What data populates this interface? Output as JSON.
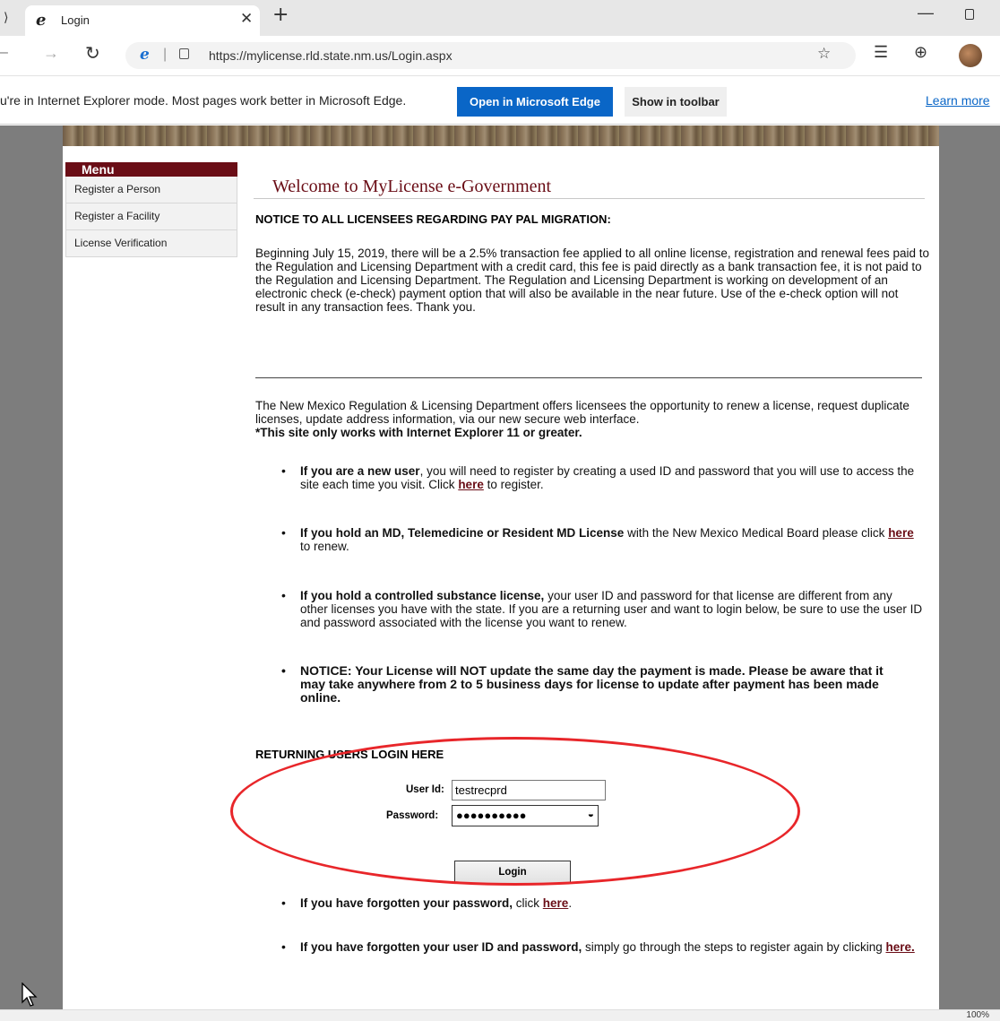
{
  "browser": {
    "tab_title": "Login",
    "url": "https://mylicense.rld.state.nm.us/Login.aspx",
    "zoom": "100%"
  },
  "ie_mode_bar": {
    "message": "u're in Internet Explorer mode. Most pages work better in Microsoft Edge.",
    "open_edge_label": "Open in Microsoft Edge",
    "show_toolbar_label": "Show in toolbar",
    "learn_more_label": "Learn more",
    "accent_color": "#0a66c7"
  },
  "menu": {
    "title": "Menu",
    "items": [
      {
        "label": "Register a Person"
      },
      {
        "label": "Register a Facility"
      },
      {
        "label": "License Verification"
      }
    ]
  },
  "main": {
    "welcome_title": "Welcome to MyLicense e-Government",
    "notice_heading": "NOTICE TO ALL LICENSEES REGARDING PAY PAL MIGRATION:",
    "notice_body": "Beginning July 15, 2019, there will be a 2.5% transaction fee applied to all online license, registration and renewal fees paid to the Regulation and Licensing Department with a credit card, this fee is paid directly as a bank transaction fee, it is not paid to the Regulation and Licensing Department. The Regulation and Licensing Department is working on development of an electronic check (e-check) payment option that will also be available in the near future. Use of the e-check option will not result in any transaction fees. Thank you.",
    "intro": "The New Mexico Regulation & Licensing Department offers licensees the opportunity to renew a license, request duplicate licenses, update address information, via our new secure web interface.",
    "ie_requirement": "*This site only works with Internet Explorer 11 or greater.",
    "bullet_new_user_bold": "If you are a new user",
    "bullet_new_user_text": ", you will need to register by creating a used ID and password that you will use to access the site each time you visit. Click ",
    "bullet_new_user_link": "here",
    "bullet_new_user_tail": " to register.",
    "bullet_md_bold": "If you hold an MD, Telemedicine or Resident MD License",
    "bullet_md_text": " with the New Mexico Medical Board please click ",
    "bullet_md_link": "here",
    "bullet_md_tail": " to renew.",
    "bullet_cs_bold": "If you hold a controlled substance license,",
    "bullet_cs_text": " your user ID and password for that license are different from any other licenses you have with the state. If you are a returning user and want to login below, be sure to use the user ID and password associated with the license you want to renew.",
    "bullet_notice": "NOTICE: Your License will NOT update the same day the payment is made. Please be aware that it may take anywhere from 2 to 5 business days for license to update after payment has been made online.",
    "brand_color": "#6a0d16"
  },
  "login": {
    "heading": "RETURNING USERS LOGIN HERE",
    "user_label": "User Id:",
    "user_value": "testrecprd",
    "password_label": "Password:",
    "password_masked": "●●●●●●●●●●",
    "button_label": "Login",
    "highlight_color": "#e8262a"
  },
  "forgot": {
    "password_bold": "If you have forgotten your password,",
    "password_text": " click ",
    "password_link": "here",
    "password_tail": ".",
    "userid_bold": "If you have forgotten your user ID and password,",
    "userid_text": " simply go through the steps to register again by clicking ",
    "userid_link": "here."
  }
}
